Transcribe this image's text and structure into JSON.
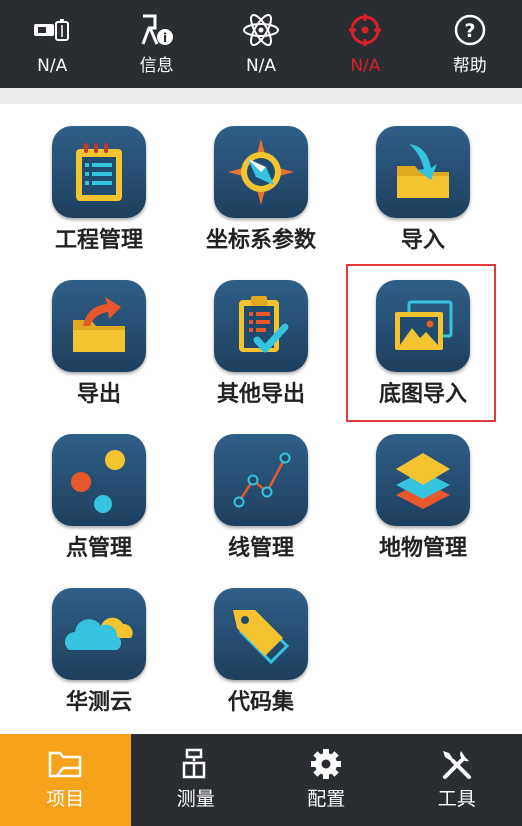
{
  "topbar": {
    "items": [
      {
        "label": "N/A",
        "icon": "battery-icon"
      },
      {
        "label": "信息",
        "icon": "info-antenna-icon"
      },
      {
        "label": "N/A",
        "icon": "atom-icon"
      },
      {
        "label": "N/A",
        "icon": "crosshair-icon",
        "state": "alert",
        "color": "#d8202b"
      },
      {
        "label": "帮助",
        "icon": "help-icon"
      }
    ]
  },
  "tiles": [
    {
      "label": "工程管理",
      "icon": "project-notebook-icon"
    },
    {
      "label": "坐标系参数",
      "icon": "compass-icon"
    },
    {
      "label": "导入",
      "icon": "import-folder-icon"
    },
    {
      "label": "导出",
      "icon": "export-folder-icon"
    },
    {
      "label": "其他导出",
      "icon": "clipboard-check-icon"
    },
    {
      "label": "底图导入",
      "icon": "basemap-image-icon",
      "highlighted": true
    },
    {
      "label": "点管理",
      "icon": "points-icon"
    },
    {
      "label": "线管理",
      "icon": "polyline-icon"
    },
    {
      "label": "地物管理",
      "icon": "layers-icon"
    },
    {
      "label": "华测云",
      "icon": "cloud-icon"
    },
    {
      "label": "代码集",
      "icon": "tag-icon"
    }
  ],
  "bottom_nav": {
    "items": [
      {
        "label": "项目",
        "icon": "project-folder-icon",
        "active": true
      },
      {
        "label": "测量",
        "icon": "survey-icon"
      },
      {
        "label": "配置",
        "icon": "settings-gear-icon"
      },
      {
        "label": "工具",
        "icon": "tools-icon"
      }
    ]
  },
  "colors": {
    "bar_background": "#2a2d32",
    "active_tab": "#f7a21b",
    "alert": "#d8202b",
    "highlight_border": "#e03b3b",
    "icon_background": "#24486b"
  }
}
